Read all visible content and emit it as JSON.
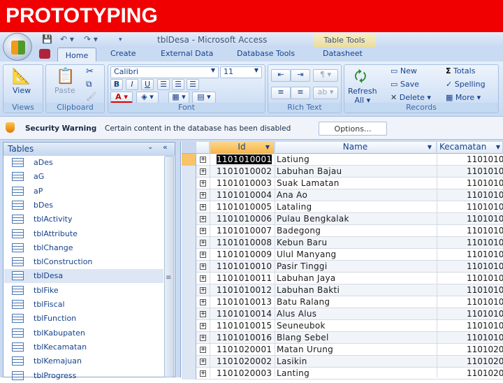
{
  "slide_title": "PROTOTYPING",
  "window": {
    "title": "tblDesa - Microsoft Access",
    "context_tab": "Table Tools"
  },
  "tabs": [
    "Home",
    "Create",
    "External Data",
    "Database Tools",
    "Datasheet"
  ],
  "ribbon": {
    "views": {
      "label": "Views",
      "view": "View"
    },
    "clipboard": {
      "label": "Clipboard",
      "paste": "Paste"
    },
    "font": {
      "label": "Font",
      "family": "Calibri",
      "size": "11",
      "bold": "B",
      "italic": "I",
      "underline": "U"
    },
    "rich_text": {
      "label": "Rich Text"
    },
    "records": {
      "label": "Records",
      "refresh": "Refresh",
      "refresh2": "All",
      "new": "New",
      "save": "Save",
      "delete": "Delete",
      "totals": "Totals",
      "spelling": "Spelling",
      "more": "More"
    }
  },
  "security": {
    "title": "Security Warning",
    "message": "Certain content in the database has been disabled",
    "options": "Options..."
  },
  "nav": {
    "header": "Tables",
    "selected": "tblDesa",
    "items": [
      "aDes",
      "aG",
      "aP",
      "bDes",
      "tblActivity",
      "tblAttribute",
      "tblChange",
      "tblConstruction",
      "tblDesa",
      "tblFike",
      "tblFiscal",
      "tblFunction",
      "tblKabupaten",
      "tblKecamatan",
      "tblKemajuan",
      "tblProgress"
    ]
  },
  "table": {
    "columns": [
      "Id",
      "Name",
      "Kecamatan"
    ],
    "rows": [
      [
        "1101010001",
        "Latiung",
        "1101010"
      ],
      [
        "1101010002",
        "Labuhan Bajau",
        "1101010"
      ],
      [
        "1101010003",
        "Suak Lamatan",
        "1101010"
      ],
      [
        "1101010004",
        "Ana Ao",
        "1101010"
      ],
      [
        "1101010005",
        "Lataling",
        "1101010"
      ],
      [
        "1101010006",
        "Pulau Bengkalak",
        "1101010"
      ],
      [
        "1101010007",
        "Badegong",
        "1101010"
      ],
      [
        "1101010008",
        "Kebun Baru",
        "1101010"
      ],
      [
        "1101010009",
        "Ulul Manyang",
        "1101010"
      ],
      [
        "1101010010",
        "Pasir Tinggi",
        "1101010"
      ],
      [
        "1101010011",
        "Labuhan Jaya",
        "1101010"
      ],
      [
        "1101010012",
        "Labuhan Bakti",
        "1101010"
      ],
      [
        "1101010013",
        "Batu Ralang",
        "1101010"
      ],
      [
        "1101010014",
        "Alus Alus",
        "1101010"
      ],
      [
        "1101010015",
        "Seuneubok",
        "1101010"
      ],
      [
        "1101010016",
        "Blang Sebel",
        "1101010"
      ],
      [
        "1101020001",
        "Matan Urung",
        "1101020"
      ],
      [
        "1101020002",
        "Lasikin",
        "1101020"
      ],
      [
        "1101020003",
        "Lanting",
        "1101020"
      ]
    ]
  }
}
